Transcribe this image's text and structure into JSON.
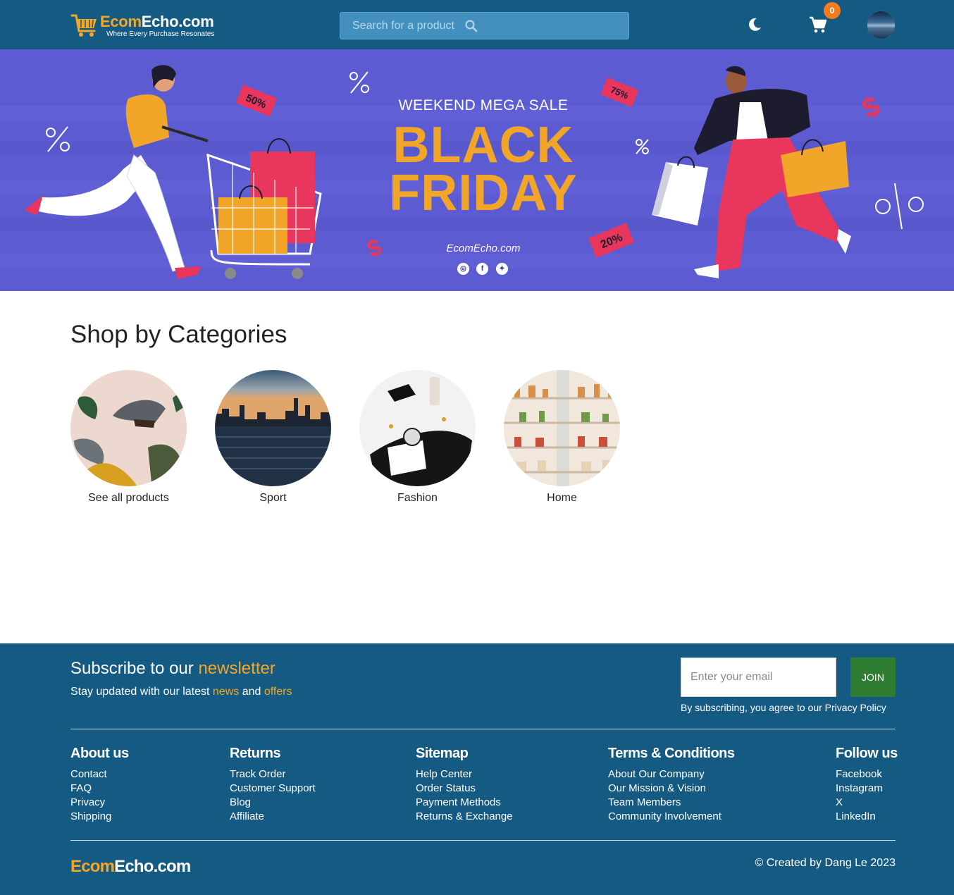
{
  "header": {
    "logo_part1": "Ecom",
    "logo_part2": "Echo.com",
    "tagline": "Where Every Purchase Resonates",
    "search_placeholder": "Search for a product",
    "cart_count": "0",
    "accent": "#f5a623",
    "bg": "#145a82"
  },
  "banner": {
    "subtitle": "WEEKEND MEGA SALE",
    "title_line1": "BLACK",
    "title_line2": "FRIDAY",
    "site": "EcomEcho.com",
    "tag_50": "50%",
    "tag_75": "75%",
    "tag_20": "20%",
    "social_icons": [
      "instagram-icon",
      "facebook-icon",
      "twitter-icon"
    ]
  },
  "categories": {
    "heading": "Shop by Categories",
    "items": [
      {
        "label": "See all products"
      },
      {
        "label": "Sport"
      },
      {
        "label": "Fashion"
      },
      {
        "label": "Home"
      }
    ]
  },
  "newsletter": {
    "title_pre": "Subscribe to our ",
    "title_hl": "newsletter",
    "sub_pre": "Stay updated with our latest ",
    "sub_hl1": "news",
    "sub_mid": " and ",
    "sub_hl2": "offers",
    "email_placeholder": "Enter your email",
    "join_label": "JOIN",
    "policy": "By subscribing, you agree to our Privacy Policy"
  },
  "footer": {
    "columns": [
      {
        "title": "About us",
        "links": [
          "Contact",
          "FAQ",
          "Privacy",
          "Shipping"
        ]
      },
      {
        "title": "Returns",
        "links": [
          "Track Order",
          "Customer Support",
          "Blog",
          "Affiliate"
        ]
      },
      {
        "title": "Sitemap",
        "links": [
          "Help Center",
          "Order Status",
          "Payment Methods",
          "Returns & Exchange"
        ]
      },
      {
        "title": "Terms & Conditions",
        "links": [
          "About Our Company",
          "Our Mission & Vision",
          "Team Members",
          "Community Involvement"
        ]
      },
      {
        "title": "Follow us",
        "links": [
          "Facebook",
          "Instagram",
          "X",
          "LinkedIn"
        ]
      }
    ],
    "logo_part1": "Ecom",
    "logo_part2": "Echo.com",
    "credit": "© Created by Dang Le 2023"
  }
}
